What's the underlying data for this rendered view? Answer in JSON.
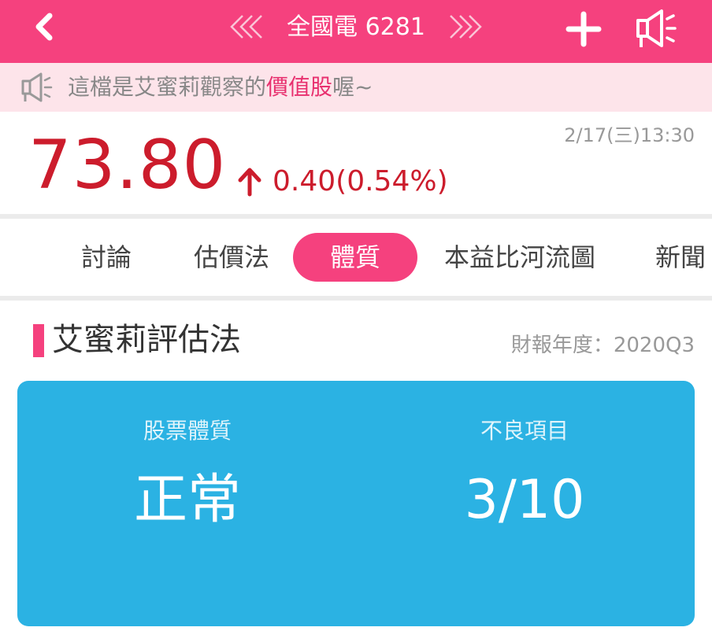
{
  "header": {
    "title": "全國電 6281",
    "back_icon": "chevron-left-icon",
    "prev_icon": "double-chevron-left-icon",
    "next_icon": "double-chevron-right-icon",
    "add_icon": "plus-icon",
    "announce_icon": "megaphone-icon",
    "background": "#f5417e"
  },
  "notice": {
    "icon": "megaphone-icon",
    "text_before": "這檔是艾蜜莉觀察的",
    "highlight": "價值股",
    "text_after": "喔~",
    "background": "#fde4ea",
    "highlight_color": "#e8306f"
  },
  "quote": {
    "timestamp": "2/17(三)13:30",
    "price": "73.80",
    "direction_icon": "arrow-up-icon",
    "change": "0.40(0.54%)",
    "price_color": "#cc1c2c"
  },
  "tabs": {
    "items": [
      {
        "label": "討論",
        "active": false
      },
      {
        "label": "估價法",
        "active": false
      },
      {
        "label": "體質",
        "active": true
      },
      {
        "label": "本益比河流圖",
        "active": false
      },
      {
        "label": "新聞",
        "active": false
      }
    ],
    "active_color": "#f5417e"
  },
  "section": {
    "title": "艾蜜莉評估法",
    "period": "財報年度：2020Q3"
  },
  "card": {
    "background": "#2bb2e3",
    "left_label": "股票體質",
    "left_value": "正常",
    "right_label": "不良項目",
    "right_value": "3/10"
  }
}
